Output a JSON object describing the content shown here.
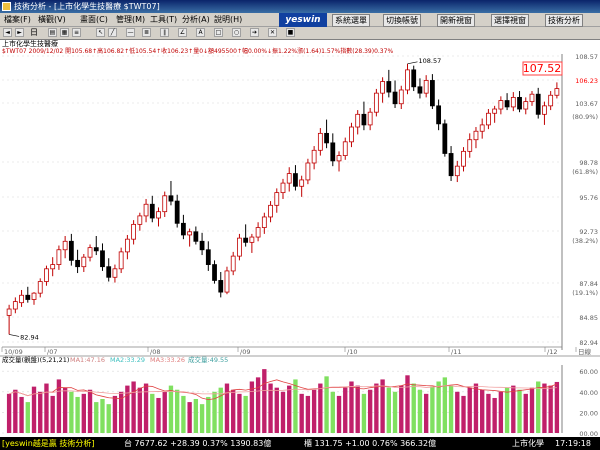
{
  "window": {
    "title": "技術分析 - [上市化學生技醫療 $TWT07]"
  },
  "menu": [
    "檔案(F)",
    "橫觀(V)",
    "畫面(C)",
    "管理(M)",
    "工具(T)",
    "分析(A)",
    "說明(H)"
  ],
  "logo": "yeswin",
  "right_buttons": [
    "系統選單",
    "切換帳號",
    "開新視窗",
    "選擇視窗",
    "技術分析"
  ],
  "toolbar": {
    "period_label": "日",
    "left_icons": [
      "prev-icon",
      "next-icon"
    ]
  },
  "chart": {
    "name": "上市化學生技醫療",
    "info_line": "$TWT07 2009/12/02 開105.68↑高106.82↑低105.54↑收106.23↑量0↓額495500↑幅0.00%↓振1.22%漲(1.64)1.57%指數(28.39)0.37%",
    "y_ticks": [
      "108.57",
      "106.23",
      "103.67",
      "(80.9%)",
      "98.78",
      "(61.8%)",
      "95.76",
      "92.73",
      "(38.2%)",
      "87.84",
      "(19.1%)",
      "84.85",
      "82.94"
    ],
    "current_price": "107.52",
    "high_label": "108.57",
    "low_label": "82.94",
    "x_labels": [
      "10/09",
      "/07",
      "/08",
      "/09",
      "/10",
      "/11",
      "/12",
      "日線"
    ],
    "indicator_header": "成交量(觀盤)(5,21,21)",
    "indicator_values": [
      "MA1:47.16",
      "MA2:33.29",
      "MA3:33.26",
      "成交量:49.55"
    ],
    "indicator_ticks": [
      "60.00",
      "40.00",
      "20.00",
      "00.00"
    ]
  },
  "status": {
    "brand": "[yeswin越是贏 技術分析]",
    "taiex": "台 7677.62 +28.39 0.37% 1390.83億",
    "otc": "櫃 131.75 +1.00 0.76% 366.32億",
    "market": "上市化學",
    "time": "17:19:18"
  },
  "chart_data": {
    "type": "candlestick",
    "title": "上市化學生技醫療",
    "ylim": [
      82,
      109.5
    ],
    "candles": [
      [
        84.8,
        85.8,
        83.0,
        85.4
      ],
      [
        85.4,
        86.5,
        85.0,
        86.1
      ],
      [
        86.0,
        87.2,
        85.6,
        86.7
      ],
      [
        86.7,
        87.5,
        86.0,
        86.3
      ],
      [
        86.3,
        87.0,
        85.8,
        86.9
      ],
      [
        86.9,
        88.3,
        86.5,
        88.0
      ],
      [
        88.0,
        89.5,
        87.6,
        89.2
      ],
      [
        89.2,
        90.3,
        88.5,
        89.6
      ],
      [
        89.6,
        91.4,
        89.1,
        91.0
      ],
      [
        91.0,
        92.3,
        90.2,
        91.8
      ],
      [
        91.8,
        92.5,
        89.5,
        90.0
      ],
      [
        90.0,
        91.0,
        88.8,
        89.4
      ],
      [
        89.4,
        90.6,
        88.9,
        90.3
      ],
      [
        90.3,
        91.5,
        89.9,
        91.2
      ],
      [
        91.2,
        92.3,
        90.5,
        90.9
      ],
      [
        90.9,
        91.6,
        89.0,
        89.4
      ],
      [
        89.4,
        90.2,
        88.0,
        88.4
      ],
      [
        88.4,
        89.6,
        87.9,
        89.2
      ],
      [
        89.2,
        91.2,
        88.8,
        90.8
      ],
      [
        90.8,
        92.4,
        90.1,
        92.0
      ],
      [
        92.0,
        93.8,
        91.5,
        93.4
      ],
      [
        93.4,
        94.5,
        92.8,
        94.2
      ],
      [
        94.2,
        95.8,
        93.6,
        95.3
      ],
      [
        95.3,
        96.1,
        93.6,
        94.0
      ],
      [
        94.0,
        95.0,
        93.2,
        94.6
      ],
      [
        94.6,
        96.5,
        94.1,
        96.1
      ],
      [
        96.1,
        97.5,
        95.2,
        95.6
      ],
      [
        95.6,
        96.2,
        93.1,
        93.5
      ],
      [
        93.5,
        94.3,
        92.0,
        92.4
      ],
      [
        92.4,
        93.0,
        91.3,
        92.7
      ],
      [
        92.7,
        93.2,
        91.5,
        91.8
      ],
      [
        91.8,
        92.6,
        90.5,
        91.0
      ],
      [
        91.0,
        91.8,
        89.0,
        89.6
      ],
      [
        89.6,
        90.0,
        87.8,
        88.1
      ],
      [
        88.1,
        88.9,
        86.5,
        87.0
      ],
      [
        87.0,
        89.4,
        86.8,
        89.0
      ],
      [
        89.0,
        90.8,
        88.6,
        90.4
      ],
      [
        90.4,
        92.5,
        90.0,
        92.1
      ],
      [
        92.1,
        93.4,
        91.3,
        91.7
      ],
      [
        91.7,
        92.5,
        90.7,
        92.2
      ],
      [
        92.2,
        93.6,
        91.8,
        93.1
      ],
      [
        93.1,
        94.5,
        92.5,
        94.1
      ],
      [
        94.1,
        95.6,
        93.6,
        95.2
      ],
      [
        95.2,
        96.8,
        94.5,
        96.4
      ],
      [
        96.4,
        97.7,
        95.8,
        97.3
      ],
      [
        97.3,
        98.8,
        96.5,
        98.2
      ],
      [
        98.2,
        99.0,
        96.6,
        97.0
      ],
      [
        97.0,
        98.0,
        96.0,
        97.6
      ],
      [
        97.6,
        99.6,
        97.2,
        99.2
      ],
      [
        99.2,
        100.8,
        98.6,
        100.4
      ],
      [
        100.4,
        102.5,
        99.9,
        102.0
      ],
      [
        102.0,
        103.3,
        100.6,
        101.1
      ],
      [
        101.1,
        102.0,
        98.9,
        99.4
      ],
      [
        99.4,
        100.3,
        98.4,
        99.9
      ],
      [
        99.9,
        101.6,
        99.5,
        101.2
      ],
      [
        101.2,
        103.0,
        100.7,
        102.6
      ],
      [
        102.6,
        104.2,
        101.9,
        103.8
      ],
      [
        103.8,
        105.0,
        102.3,
        102.8
      ],
      [
        102.8,
        104.4,
        102.3,
        104.0
      ],
      [
        104.0,
        106.2,
        103.6,
        105.8
      ],
      [
        105.8,
        107.3,
        104.9,
        106.9
      ],
      [
        106.9,
        108.0,
        105.4,
        105.9
      ],
      [
        105.9,
        107.0,
        104.4,
        104.8
      ],
      [
        104.8,
        106.5,
        104.3,
        106.1
      ],
      [
        106.1,
        108.57,
        105.7,
        108.0
      ],
      [
        108.0,
        108.4,
        106.0,
        106.4
      ],
      [
        106.4,
        107.2,
        105.3,
        105.8
      ],
      [
        105.8,
        107.5,
        105.4,
        107.0
      ],
      [
        107.0,
        107.6,
        104.3,
        104.6
      ],
      [
        104.6,
        105.2,
        102.3,
        102.9
      ],
      [
        102.9,
        103.3,
        99.8,
        100.1
      ],
      [
        100.1,
        100.8,
        97.5,
        98.0
      ],
      [
        98.0,
        99.4,
        97.4,
        98.9
      ],
      [
        98.9,
        100.7,
        98.4,
        100.3
      ],
      [
        100.3,
        102.0,
        99.7,
        101.4
      ],
      [
        101.4,
        102.6,
        100.6,
        102.2
      ],
      [
        102.2,
        103.4,
        101.5,
        102.8
      ],
      [
        102.8,
        104.3,
        102.4,
        103.9
      ],
      [
        103.9,
        104.6,
        103.0,
        104.3
      ],
      [
        104.3,
        105.5,
        103.8,
        105.1
      ],
      [
        105.1,
        105.8,
        104.2,
        104.5
      ],
      [
        104.5,
        105.9,
        104.1,
        105.4
      ],
      [
        105.4,
        106.0,
        104.0,
        104.3
      ],
      [
        104.3,
        105.4,
        103.8,
        105.0
      ],
      [
        105.0,
        106.0,
        104.6,
        105.7
      ],
      [
        105.7,
        106.3,
        103.4,
        103.8
      ],
      [
        103.8,
        105.0,
        102.8,
        104.6
      ],
      [
        104.6,
        106.0,
        104.2,
        105.6
      ],
      [
        105.6,
        106.82,
        105.3,
        106.23
      ]
    ],
    "volume": [
      38,
      42,
      35,
      30,
      45,
      40,
      48,
      36,
      52,
      44,
      40,
      35,
      38,
      42,
      30,
      33,
      28,
      36,
      40,
      46,
      50,
      44,
      48,
      38,
      34,
      40,
      46,
      42,
      36,
      30,
      33,
      28,
      35,
      40,
      44,
      48,
      42,
      38,
      36,
      50,
      54,
      62,
      48,
      44,
      40,
      46,
      52,
      38,
      36,
      42,
      48,
      55,
      40,
      36,
      44,
      50,
      46,
      38,
      42,
      48,
      52,
      44,
      40,
      46,
      56,
      48,
      42,
      38,
      45,
      50,
      54,
      46,
      40,
      36,
      44,
      48,
      42,
      38,
      34,
      40,
      44,
      46,
      42,
      38,
      44,
      50,
      48,
      46,
      49.55
    ]
  }
}
